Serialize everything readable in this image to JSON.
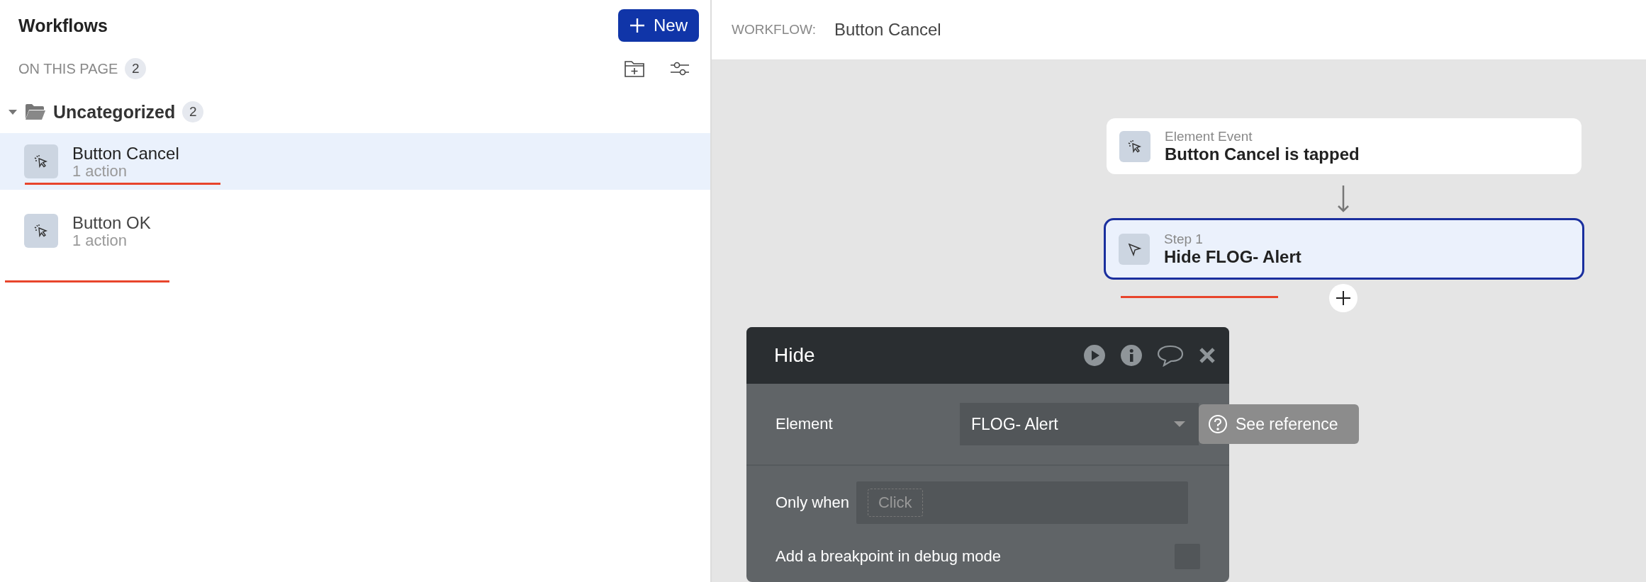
{
  "sidebar": {
    "title": "Workflows",
    "new_button": "New",
    "section": {
      "label": "ON THIS PAGE",
      "count": "2"
    },
    "folders": [
      {
        "name": "Uncategorized",
        "count": "2",
        "expanded": true,
        "items": [
          {
            "name": "Button Cancel",
            "subtitle": "1 action",
            "selected": true
          },
          {
            "name": "Button OK",
            "subtitle": "1 action",
            "selected": false
          }
        ]
      }
    ]
  },
  "workflow_header": {
    "label": "WORKFLOW:",
    "name": "Button Cancel"
  },
  "canvas": {
    "event": {
      "label": "Element Event",
      "title": "Button Cancel is tapped"
    },
    "steps": [
      {
        "label": "Step 1",
        "title": "Hide FLOG- Alert",
        "selected": true
      }
    ]
  },
  "action_panel": {
    "title": "Hide",
    "fields": [
      {
        "kind": "dropdown",
        "label": "Element",
        "value": "FLOG- Alert",
        "reference_button": "See reference"
      },
      {
        "kind": "condition",
        "label": "Only when",
        "placeholder": "Click"
      },
      {
        "kind": "checkbox",
        "label": "Add a breakpoint in debug mode",
        "checked": false
      }
    ]
  }
}
